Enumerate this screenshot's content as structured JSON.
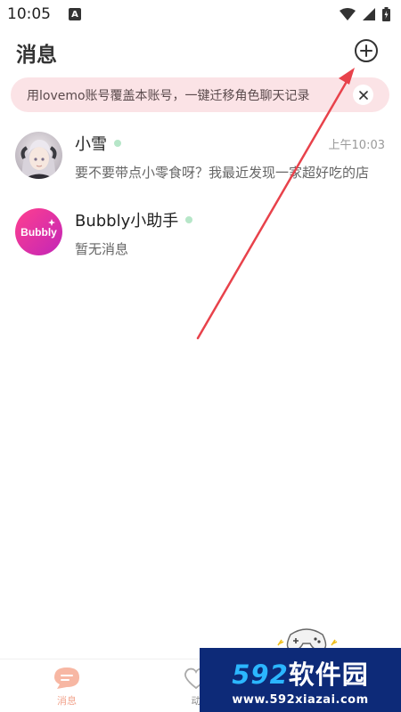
{
  "status_bar": {
    "time": "10:05",
    "notif_letter": "A"
  },
  "header": {
    "title": "消息"
  },
  "banner": {
    "text": "用lovemo账号覆盖本账号，一键迁移角色聊天记录"
  },
  "chats": [
    {
      "name": "小雪",
      "time": "上午10:03",
      "preview": "要不要带点小零食呀？我最近发现一家超好吃的店",
      "online": true
    },
    {
      "name": "Bubbly小助手",
      "time": "",
      "preview": "暂无消息",
      "online": true,
      "avatar_text": "Bubbly"
    }
  ],
  "bottom_nav": {
    "messages_label": "消息",
    "moments_label": "动"
  },
  "watermark": {
    "logo_num": "592",
    "logo_cn": "软件园",
    "url": "www.592xiazai.com"
  },
  "colors": {
    "accent": "#f2a48e",
    "banner_bg": "#fbe3e6",
    "online": "#b6e6c8",
    "arrow": "#e8424b"
  }
}
